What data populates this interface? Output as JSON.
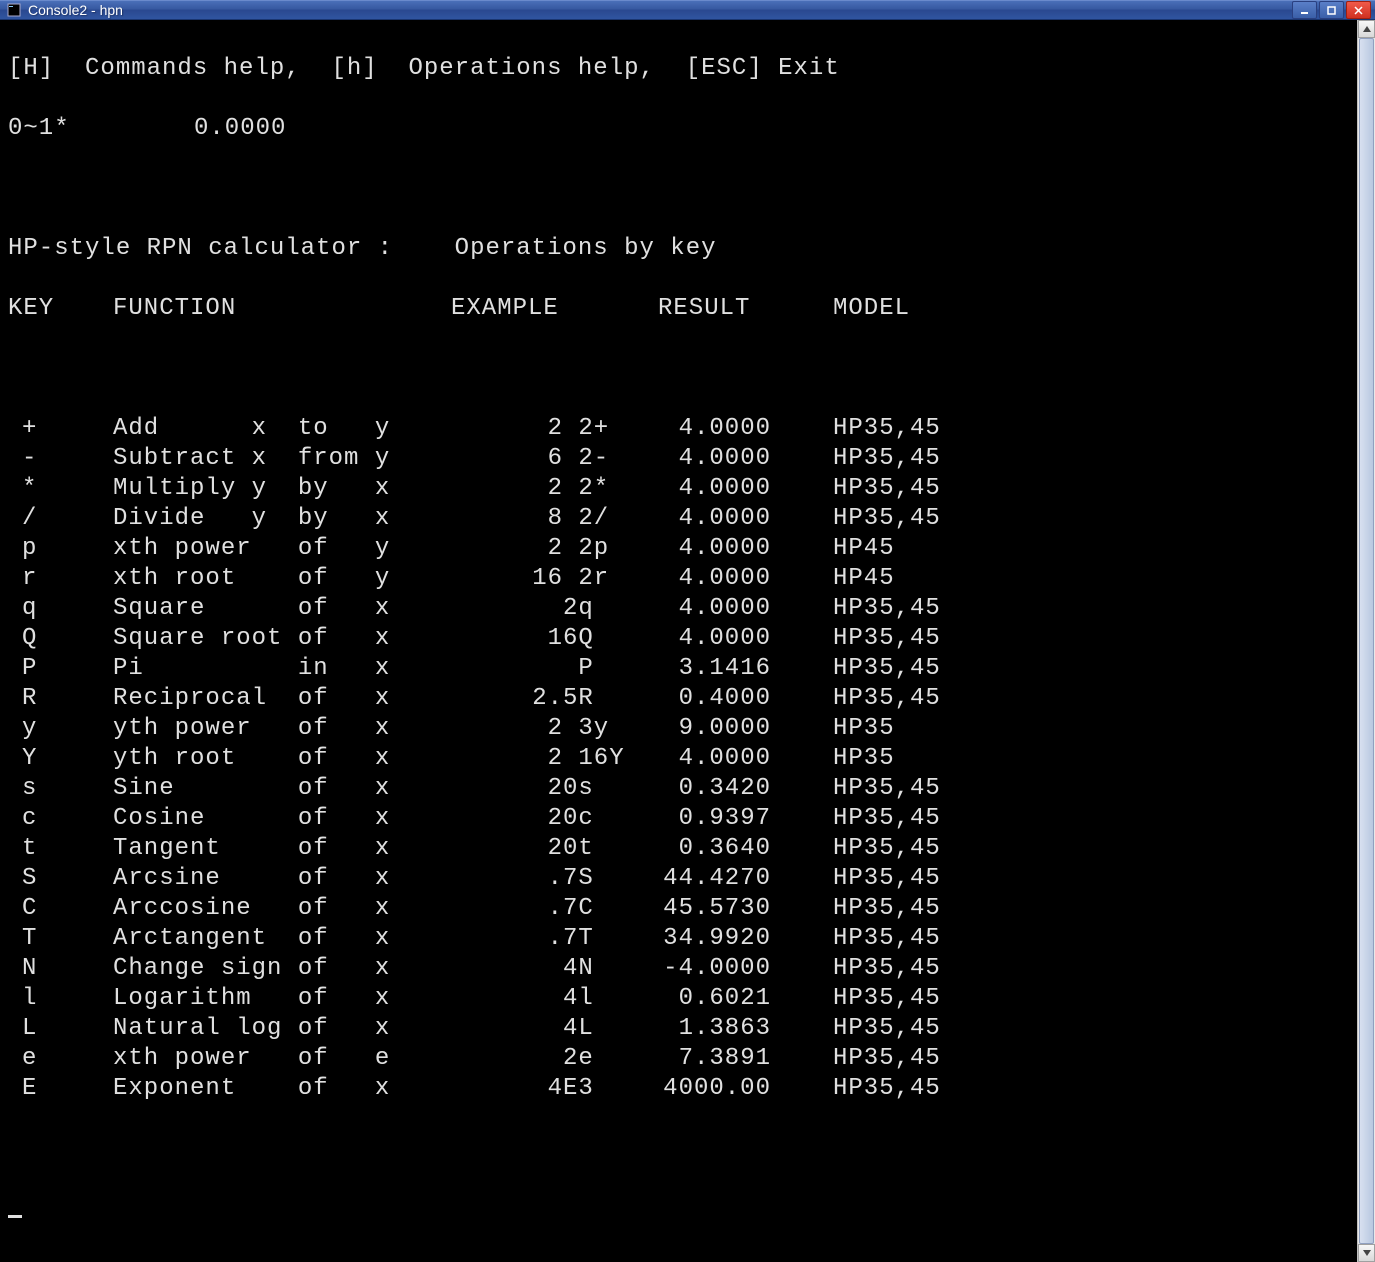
{
  "window": {
    "title": "Console2 - hpn"
  },
  "header": {
    "help_line": "[H]  Commands help,  [h]  Operations help,  [ESC] Exit"
  },
  "status": {
    "prompt": "0~1*",
    "value": "0.0000"
  },
  "subtitle": "HP-style RPN calculator :    Operations by key",
  "columns": {
    "key": "KEY",
    "function": "FUNCTION",
    "example": "EXAMPLE",
    "result": "RESULT",
    "model": "MODEL"
  },
  "operations": [
    {
      "key": "+",
      "function": "Add      x  to   y",
      "ex_l": "2",
      "ex_r": " 2+",
      "result": "4.0000",
      "model": "HP35,45"
    },
    {
      "key": "-",
      "function": "Subtract x  from y",
      "ex_l": "6",
      "ex_r": " 2-",
      "result": "4.0000",
      "model": "HP35,45"
    },
    {
      "key": "*",
      "function": "Multiply y  by   x",
      "ex_l": "2",
      "ex_r": " 2*",
      "result": "4.0000",
      "model": "HP35,45"
    },
    {
      "key": "/",
      "function": "Divide   y  by   x",
      "ex_l": "8",
      "ex_r": " 2/",
      "result": "4.0000",
      "model": "HP35,45"
    },
    {
      "key": "p",
      "function": "xth power   of   y",
      "ex_l": "2",
      "ex_r": " 2p",
      "result": "4.0000",
      "model": "HP45"
    },
    {
      "key": "r",
      "function": "xth root    of   y",
      "ex_l": "16",
      "ex_r": " 2r",
      "result": "4.0000",
      "model": "HP45"
    },
    {
      "key": "q",
      "function": "Square      of   x",
      "ex_l": "",
      "ex_r": "2q",
      "result": "4.0000",
      "model": "HP35,45"
    },
    {
      "key": "Q",
      "function": "Square root of   x",
      "ex_l": "1",
      "ex_r": "6Q",
      "result": "4.0000",
      "model": "HP35,45"
    },
    {
      "key": "P",
      "function": "Pi          in   x",
      "ex_l": "",
      "ex_r": " P",
      "result": "3.1416",
      "model": "HP35,45"
    },
    {
      "key": "R",
      "function": "Reciprocal  of   x",
      "ex_l": "2.",
      "ex_r": "5R",
      "result": "0.4000",
      "model": "HP35,45"
    },
    {
      "key": "y",
      "function": "yth power   of   x",
      "ex_l": "2",
      "ex_r": " 3y",
      "result": "9.0000",
      "model": "HP35"
    },
    {
      "key": "Y",
      "function": "yth root    of   x",
      "ex_l": "2",
      "ex_r": " 16Y",
      "result": "4.0000",
      "model": "HP35"
    },
    {
      "key": "s",
      "function": "Sine        of   x",
      "ex_l": "2",
      "ex_r": "0s",
      "result": "0.3420",
      "model": "HP35,45"
    },
    {
      "key": "c",
      "function": "Cosine      of   x",
      "ex_l": "2",
      "ex_r": "0c",
      "result": "0.9397",
      "model": "HP35,45"
    },
    {
      "key": "t",
      "function": "Tangent     of   x",
      "ex_l": "2",
      "ex_r": "0t",
      "result": "0.3640",
      "model": "HP35,45"
    },
    {
      "key": "S",
      "function": "Arcsine     of   x",
      "ex_l": ".",
      "ex_r": "7S",
      "result": "44.4270",
      "model": "HP35,45"
    },
    {
      "key": "C",
      "function": "Arccosine   of   x",
      "ex_l": ".",
      "ex_r": "7C",
      "result": "45.5730",
      "model": "HP35,45"
    },
    {
      "key": "T",
      "function": "Arctangent  of   x",
      "ex_l": ".",
      "ex_r": "7T",
      "result": "34.9920",
      "model": "HP35,45"
    },
    {
      "key": "N",
      "function": "Change sign of   x",
      "ex_l": "",
      "ex_r": "4N",
      "result": "-4.0000",
      "model": "HP35,45"
    },
    {
      "key": "l",
      "function": "Logarithm   of   x",
      "ex_l": "",
      "ex_r": "4l",
      "result": "0.6021",
      "model": "HP35,45"
    },
    {
      "key": "L",
      "function": "Natural log of   x",
      "ex_l": "",
      "ex_r": "4L",
      "result": "1.3863",
      "model": "HP35,45"
    },
    {
      "key": "e",
      "function": "xth power   of   e",
      "ex_l": "",
      "ex_r": "2e",
      "result": "7.3891",
      "model": "HP35,45"
    },
    {
      "key": "E",
      "function": "Exponent    of   x",
      "ex_l": "4",
      "ex_r": "E3",
      "result": "4000.00",
      "model": "HP35,45"
    }
  ]
}
